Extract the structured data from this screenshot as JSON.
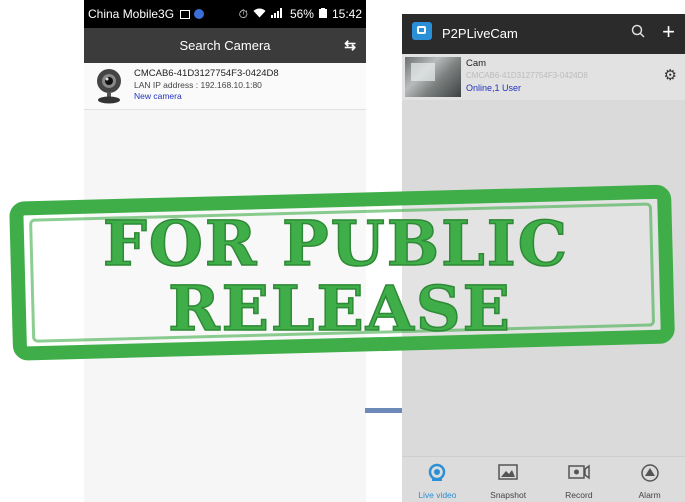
{
  "status_bar": {
    "carrier": "China Mobile3G",
    "battery": "56%",
    "time": "15:42"
  },
  "search_screen": {
    "title": "Search Camera",
    "refresh_icon": "refresh-icon",
    "camera": {
      "name": "CMCAB6-41D3127754F3-0424D8",
      "ip": "LAN IP address : 192.168.10.1:80",
      "status": "New camera"
    }
  },
  "app_screen": {
    "title": "P2PLiveCam",
    "device": {
      "name": "Cam",
      "id": "CMCAB6-41D3127754F3-0424D8",
      "status": "Online,1 User"
    },
    "nav": [
      {
        "label": "Live video",
        "icon": "live-video-icon",
        "active": true
      },
      {
        "label": "Snapshot",
        "icon": "snapshot-icon",
        "active": false
      },
      {
        "label": "Record",
        "icon": "record-icon",
        "active": false
      },
      {
        "label": "Alarm",
        "icon": "alarm-icon",
        "active": false
      }
    ]
  },
  "stamp": {
    "line1": "FOR PUBLIC",
    "line2": "RELEASE",
    "color": "#3fae49"
  },
  "colors": {
    "accent": "#2a8fd6",
    "link": "#2233bb",
    "header_dark": "#3b3b3b"
  }
}
